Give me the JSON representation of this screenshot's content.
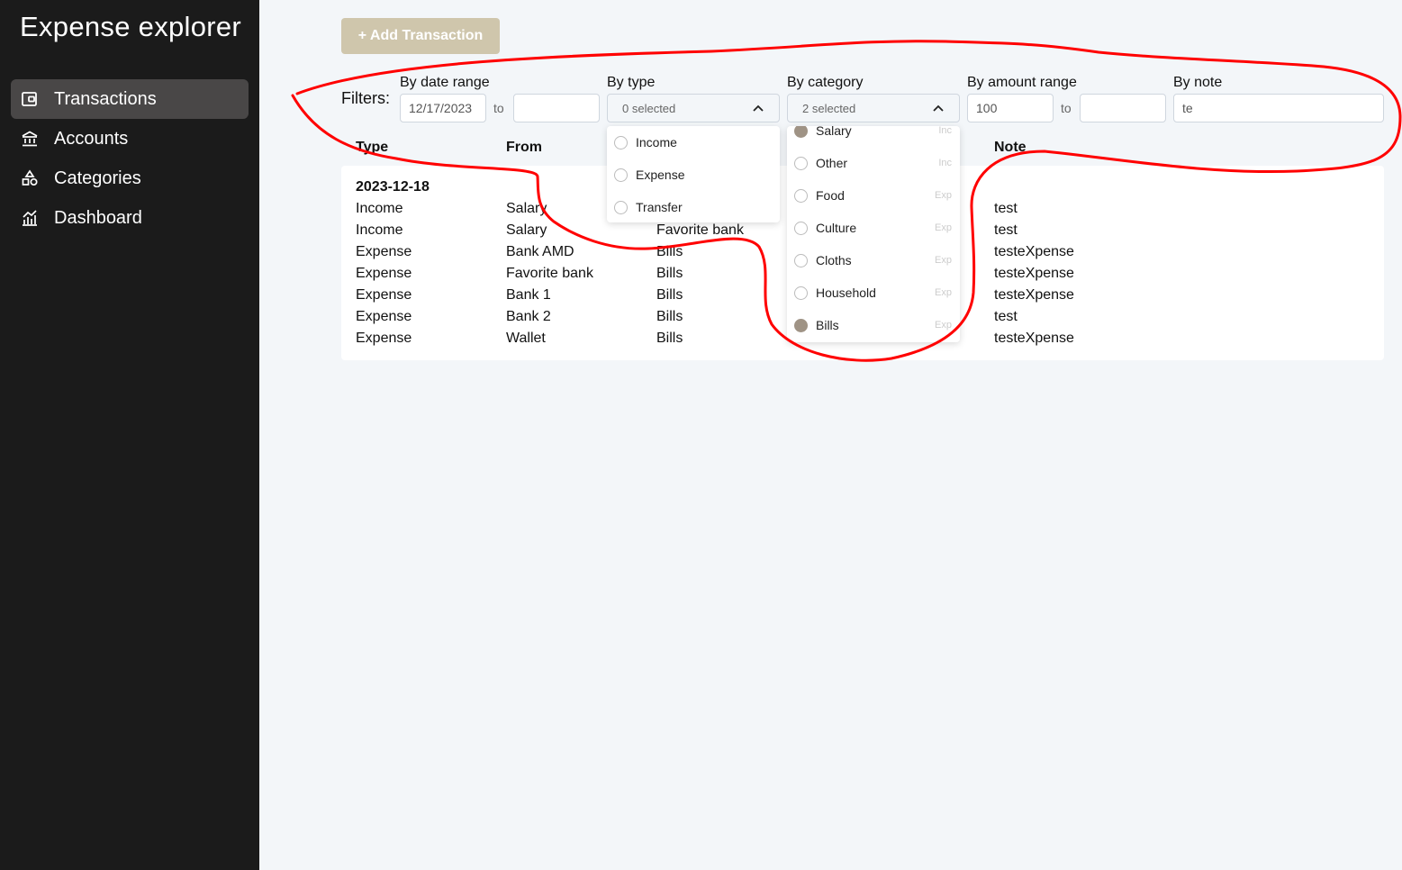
{
  "sidebar": {
    "app_title": "Expense explorer",
    "items": [
      {
        "label": "Transactions",
        "icon": "wallet-icon",
        "active": true
      },
      {
        "label": "Accounts",
        "icon": "bank-icon"
      },
      {
        "label": "Categories",
        "icon": "shapes-icon"
      },
      {
        "label": "Dashboard",
        "icon": "chart-icon"
      }
    ]
  },
  "toolbar": {
    "add_label": "+ Add Transaction"
  },
  "filters": {
    "label": "Filters:",
    "date_range": {
      "label": "By date range",
      "from": "12/17/2023",
      "to": "",
      "to_label": "to"
    },
    "type": {
      "label": "By type",
      "summary": "0 selected"
    },
    "category": {
      "label": "By category",
      "summary": "2 selected"
    },
    "amount_range": {
      "label": "By amount range",
      "from": "100",
      "to": "",
      "to_label": "to"
    },
    "note": {
      "label": "By note",
      "value": "te"
    }
  },
  "type_menu": {
    "options": [
      {
        "label": "Income",
        "checked": false
      },
      {
        "label": "Expense",
        "checked": false
      },
      {
        "label": "Transfer",
        "checked": false
      }
    ]
  },
  "category_menu": {
    "options": [
      {
        "label": "Salary",
        "tag": "Inc",
        "checked": true
      },
      {
        "label": "Other",
        "tag": "Inc",
        "checked": false
      },
      {
        "label": "Food",
        "tag": "Exp",
        "checked": false
      },
      {
        "label": "Culture",
        "tag": "Exp",
        "checked": false
      },
      {
        "label": "Cloths",
        "tag": "Exp",
        "checked": false
      },
      {
        "label": "Household",
        "tag": "Exp",
        "checked": false
      },
      {
        "label": "Bills",
        "tag": "Exp",
        "checked": true
      }
    ]
  },
  "table": {
    "headers": {
      "type": "Type",
      "from": "From",
      "note": "Note"
    },
    "groups": [
      {
        "date": "2023-12-18",
        "rows": [
          {
            "type": "Income",
            "from": "Salary",
            "to": "",
            "note": "test"
          },
          {
            "type": "Income",
            "from": "Salary",
            "to": "Favorite bank",
            "note": "test"
          },
          {
            "type": "Expense",
            "from": "Bank AMD",
            "to": "Bills",
            "note": "testeXpense"
          },
          {
            "type": "Expense",
            "from": "Favorite bank",
            "to": "Bills",
            "note": "testeXpense"
          },
          {
            "type": "Expense",
            "from": "Bank 1",
            "to": "Bills",
            "note": "testeXpense"
          },
          {
            "type": "Expense",
            "from": "Bank 2",
            "to": "Bills",
            "note": "test"
          },
          {
            "type": "Expense",
            "from": "Wallet",
            "to": "Bills",
            "note": "testeXpense"
          }
        ]
      }
    ]
  },
  "colors": {
    "sidebar_bg": "#1b1b1b",
    "sidebar_active": "#494747",
    "accent": "#cfc6ac",
    "checked": "#9f9385",
    "annotation": "#ff0000"
  }
}
